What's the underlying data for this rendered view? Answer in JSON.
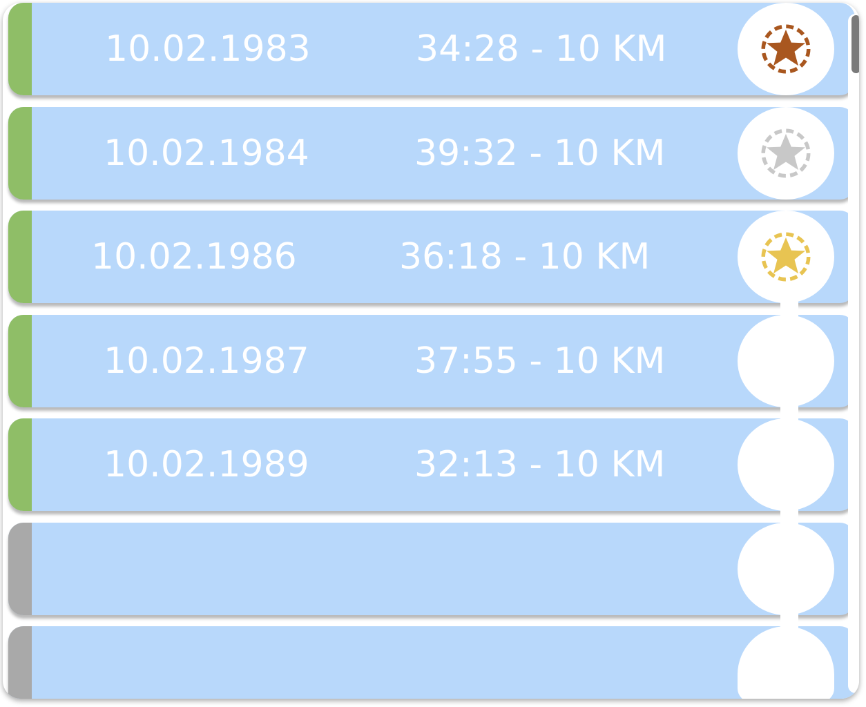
{
  "races": [
    {
      "date": "10.02.1983",
      "result": "34:28 - 10 KM",
      "status": "completed",
      "medal": "bronze-star-medal-icon"
    },
    {
      "date": "10.02.1984",
      "result": "39:32 - 10 KM",
      "status": "completed",
      "medal": "silver-star-medal-icon"
    },
    {
      "date": "10.02.1986",
      "result": "36:18 - 10 KM",
      "status": "completed",
      "medal": "gold-star-medal-icon"
    },
    {
      "date": "10.02.1987",
      "result": "37:55 - 10 KM",
      "status": "completed",
      "medal": ""
    },
    {
      "date": "10.02.1989",
      "result": "32:13 - 10 KM",
      "status": "completed",
      "medal": ""
    },
    {
      "date": "",
      "result": "",
      "status": "pending",
      "medal": ""
    },
    {
      "date": "",
      "result": "",
      "status": "pending",
      "medal": ""
    }
  ],
  "colors": {
    "row_background": "#b8d8fb",
    "completed_stripe": "#8fbe67",
    "pending_stripe": "#a9a9a9",
    "bronze": "#a9571f",
    "silver": "#c8c8c8",
    "gold": "#e8c452",
    "scroll_thumb": "#7a7a7a"
  }
}
